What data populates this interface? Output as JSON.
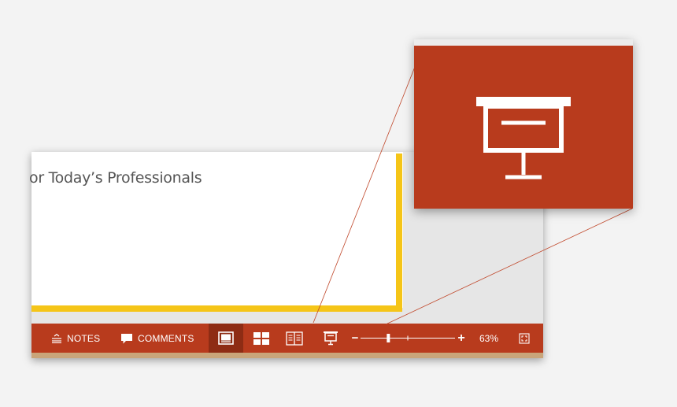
{
  "slide": {
    "title_text": "or Today’s Professionals"
  },
  "statusbar": {
    "notes_label": "NOTES",
    "comments_label": "COMMENTS",
    "zoom_minus": "−",
    "zoom_plus": "+",
    "zoom_percent": "63%",
    "zoom_level": 0.63,
    "icons": {
      "notes": "notes-icon",
      "comments": "comment-bubble-icon",
      "normal_view": "normal-view-icon",
      "slide_sorter": "slide-sorter-icon",
      "reading_view": "reading-view-icon",
      "slideshow": "slideshow-icon",
      "fit_window": "fit-to-window-icon"
    }
  },
  "colors": {
    "statusbar": "#b83b1d",
    "active_view": "#8e2c14",
    "accent": "#f5c518",
    "slide_text": "#555555"
  }
}
